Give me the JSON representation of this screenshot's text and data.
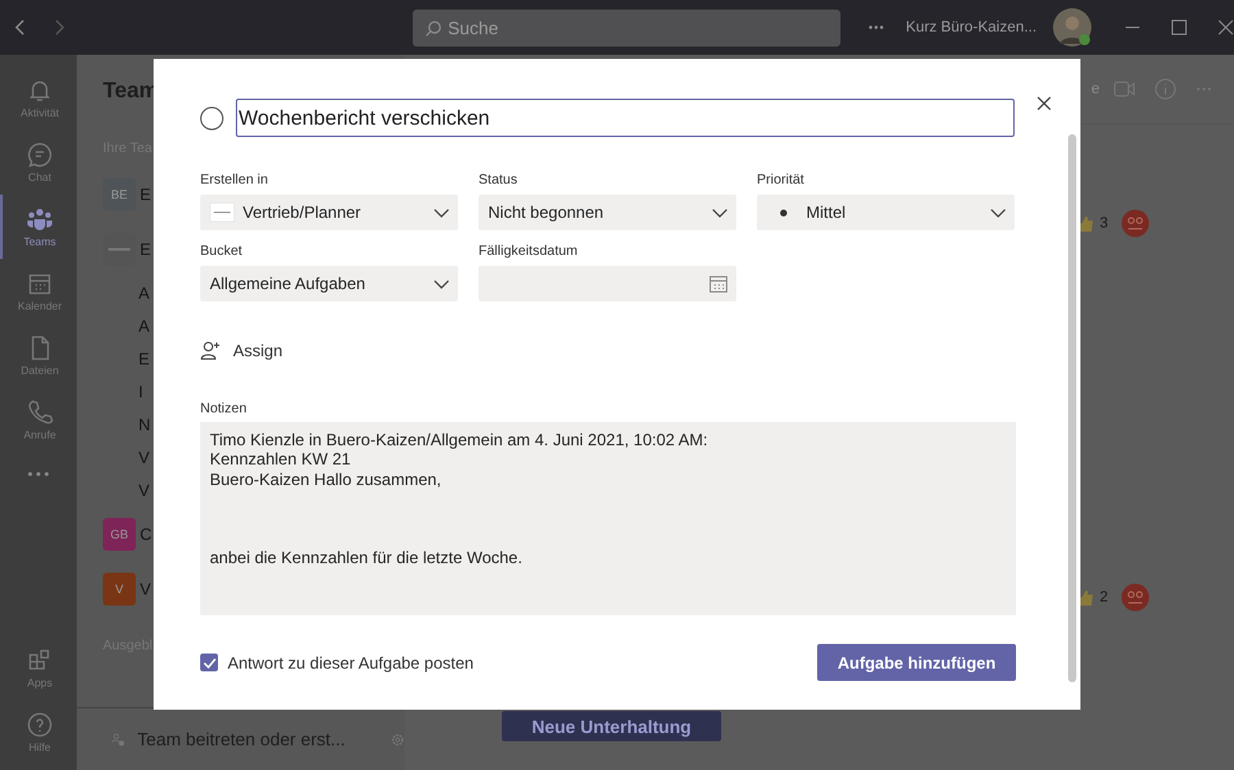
{
  "titlebar": {
    "search": {
      "placeholder": "Suche"
    },
    "user": "Kurz Büro-Kaizen..."
  },
  "rail": [
    {
      "label": "Aktivität",
      "selected": false
    },
    {
      "label": "Chat",
      "selected": false
    },
    {
      "label": "Teams",
      "selected": true
    },
    {
      "label": "Kalender",
      "selected": false
    },
    {
      "label": "Dateien",
      "selected": false
    },
    {
      "label": "Anrufe",
      "selected": false
    }
  ],
  "rail_bottom": [
    {
      "label": "Apps",
      "selected": false
    },
    {
      "label": "Hilfe",
      "selected": false
    }
  ],
  "team_panel": {
    "title": "Team",
    "section": "Ihre Tea",
    "rows": [
      {
        "kind": "team",
        "avatar": "BE",
        "name": "E",
        "color": "#4f5458"
      },
      {
        "kind": "logo",
        "name": "E"
      },
      {
        "kind": "channel",
        "name": "A"
      },
      {
        "kind": "channel",
        "name": "A"
      },
      {
        "kind": "channel",
        "name": "E"
      },
      {
        "kind": "channel",
        "name": "I"
      },
      {
        "kind": "channel",
        "name": "N"
      },
      {
        "kind": "channel",
        "name": "V"
      },
      {
        "kind": "channel",
        "name": "V"
      },
      {
        "kind": "team",
        "avatar": "GB",
        "name": "C",
        "color": "#7e2458"
      },
      {
        "kind": "team",
        "avatar": "V",
        "name": "V",
        "color": "#7a3514"
      }
    ],
    "hidden_section": "Ausgebl",
    "join": "Team beitreten oder erst..."
  },
  "main": {
    "tab": "e",
    "reactions": [
      {
        "count": "3"
      },
      {
        "count": "2"
      }
    ],
    "new_conversation": "Neue Unterhaltung"
  },
  "dialog": {
    "title": "Wochenbericht verschicken",
    "completed": false,
    "fields": [
      {
        "label": "Erstellen in",
        "value": "Vertrieb/Planner",
        "kind": "plan"
      },
      {
        "label": "Status",
        "value": "Nicht begonnen",
        "kind": "select"
      },
      {
        "label": "Priorität",
        "value": "Mittel",
        "kind": "priority"
      },
      {
        "label": "Bucket",
        "value": "Allgemeine Aufgaben",
        "kind": "select"
      },
      {
        "label": "Fälligkeitsdatum",
        "kind": "date"
      }
    ],
    "assign": "Assign",
    "notes_label": "Notizen",
    "notes": "Timo Kienzle in Buero-Kaizen/Allgemein am 4. Juni 2021, 10:02 AM:\nKennzahlen KW 21\nBuero-Kaizen Hallo zusammen,\n\n\n\nanbei die Kennzahlen für die letzte Woche.",
    "post_reply": {
      "label": "Antwort zu dieser Aufgabe posten",
      "checked": true
    },
    "submit": "Aufgabe hinzufügen"
  }
}
